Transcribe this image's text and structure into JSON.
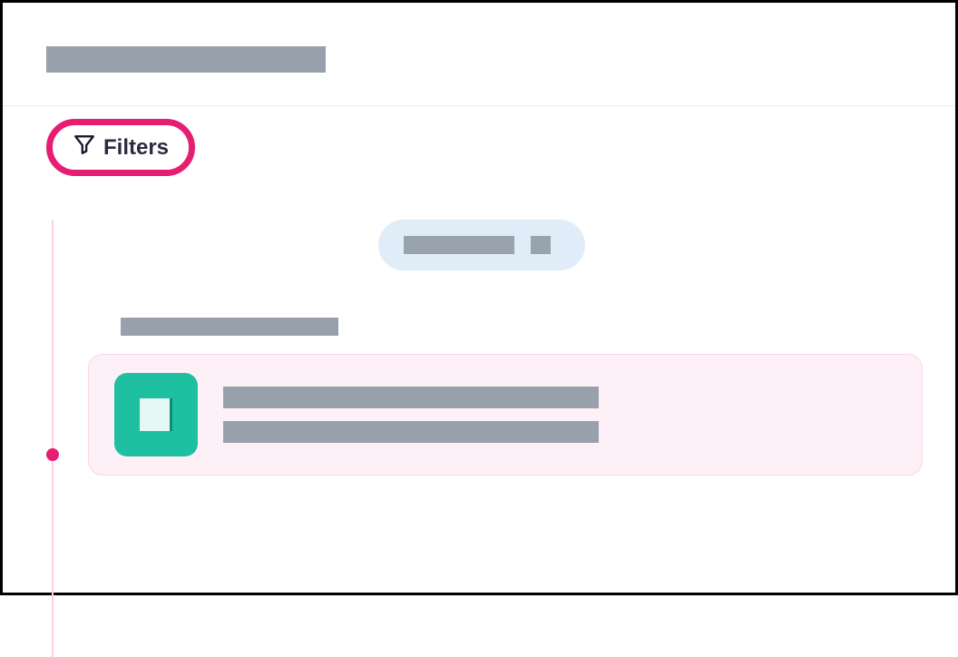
{
  "header": {
    "title_placeholder": ""
  },
  "toolbar": {
    "filters_label": "Filters"
  },
  "timeline": {
    "date_pill_text": "",
    "date_pill_badge": ""
  },
  "section": {
    "title_placeholder": "",
    "card": {
      "line1": "",
      "line2": ""
    }
  },
  "colors": {
    "accent": "#e61e72",
    "pill_bg": "#e1ecf9",
    "card_bg": "#fdf1f7",
    "icon_bg": "#1fbfa2",
    "placeholder": "#98a1ab"
  }
}
